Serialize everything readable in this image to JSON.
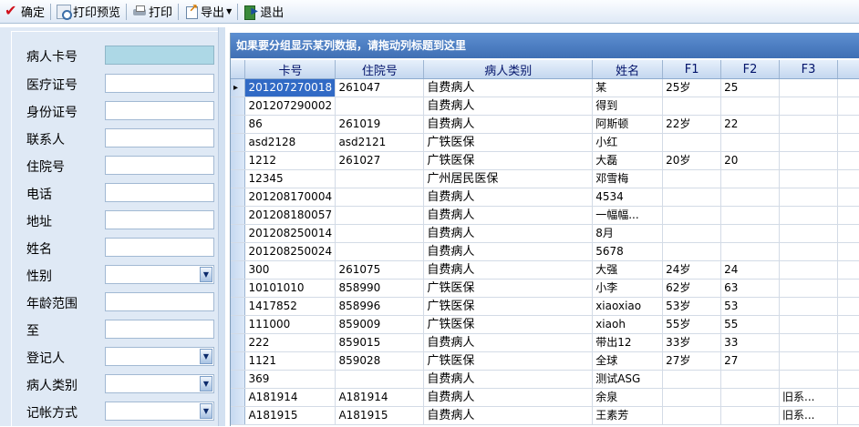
{
  "toolbar": {
    "confirm": "确定",
    "print_preview": "打印预览",
    "print": "打印",
    "export": "导出",
    "exit": "退出"
  },
  "filters": [
    {
      "label": "病人卡号",
      "kind": "readonly"
    },
    {
      "label": "医疗证号",
      "kind": "text"
    },
    {
      "label": "身份证号",
      "kind": "text"
    },
    {
      "label": "联系人",
      "kind": "text"
    },
    {
      "label": "住院号",
      "kind": "text"
    },
    {
      "label": "电话",
      "kind": "text"
    },
    {
      "label": "地址",
      "kind": "text"
    },
    {
      "label": "姓名",
      "kind": "text"
    },
    {
      "label": "性别",
      "kind": "select"
    },
    {
      "label": "年龄范围",
      "kind": "text"
    },
    {
      "label": "至",
      "kind": "text"
    },
    {
      "label": "登记人",
      "kind": "select"
    },
    {
      "label": "病人类别",
      "kind": "select"
    },
    {
      "label": "记帐方式",
      "kind": "select"
    }
  ],
  "grid": {
    "group_hint": "如果要分组显示某列数据，请拖动列标题到这里",
    "columns": [
      "卡号",
      "住院号",
      "病人类别",
      "姓名",
      "F1",
      "F2",
      "F3"
    ],
    "rows": [
      [
        "201207270018",
        "261047",
        "自费病人",
        "某",
        "25岁",
        "25",
        ""
      ],
      [
        "201207290002",
        "",
        "自费病人",
        "得到",
        "",
        "",
        ""
      ],
      [
        "86",
        "261019",
        "自费病人",
        "阿斯顿",
        "22岁",
        "22",
        ""
      ],
      [
        "asd2128",
        "asd2121",
        "广铁医保",
        "小红",
        "",
        "",
        ""
      ],
      [
        "1212",
        "261027",
        "广铁医保",
        "大磊",
        "20岁",
        "20",
        ""
      ],
      [
        "12345",
        "",
        "广州居民医保",
        "邓雪梅",
        "",
        "",
        ""
      ],
      [
        "201208170004",
        "",
        "自费病人",
        "4534",
        "",
        "",
        ""
      ],
      [
        "201208180057",
        "",
        "自费病人",
        "一幅幅...",
        "",
        "",
        ""
      ],
      [
        "201208250014",
        "",
        "自费病人",
        "8月",
        "",
        "",
        ""
      ],
      [
        "201208250024",
        "",
        "自费病人",
        "5678",
        "",
        "",
        ""
      ],
      [
        "300",
        "261075",
        "自费病人",
        "大强",
        "24岁",
        "24",
        ""
      ],
      [
        "10101010",
        "858990",
        "广铁医保",
        "小李",
        "62岁",
        "63",
        ""
      ],
      [
        "1417852",
        "858996",
        "广铁医保",
        "xiaoxiao",
        "53岁",
        "53",
        ""
      ],
      [
        "111000",
        "859009",
        "广铁医保",
        "xiaoh",
        "55岁",
        "55",
        ""
      ],
      [
        "222",
        "859015",
        "自费病人",
        "带出12",
        "33岁",
        "33",
        ""
      ],
      [
        "1121",
        "859028",
        "广铁医保",
        "全球",
        "27岁",
        "27",
        ""
      ],
      [
        "369",
        "",
        "自费病人",
        "测试ASG",
        "",
        "",
        ""
      ],
      [
        "A181914",
        "A181914",
        "自费病人",
        "余泉",
        "",
        "",
        "旧系..."
      ],
      [
        "A181915",
        "A181915",
        "自费病人",
        "王素芳",
        "",
        "",
        "旧系..."
      ]
    ]
  }
}
